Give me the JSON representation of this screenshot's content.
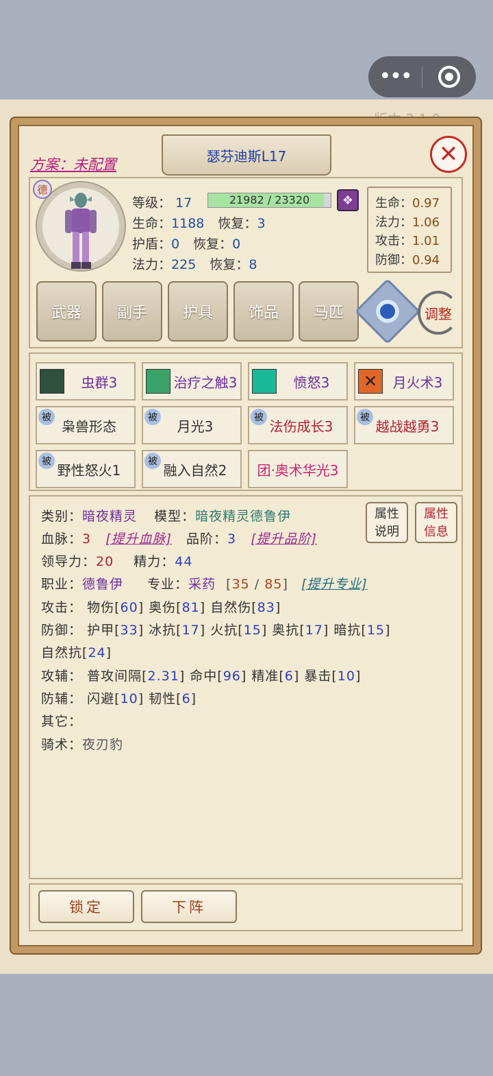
{
  "miniprogram": {
    "more_glyph": "•••",
    "version_text": "版本 2.1.0"
  },
  "header": {
    "plan": "方案：未配置",
    "title": "瑟芬迪斯L17",
    "close_glyph": "✕"
  },
  "character": {
    "badge": "德",
    "level_label": "等级：",
    "level": "17",
    "xp_text": "21982 / 23320",
    "xp_progress": 0.943,
    "hp_label": "生命：",
    "hp": "1188",
    "hp_regen_label": "恢复：",
    "hp_regen": "3",
    "shield_label": "护盾：",
    "shield": "0",
    "shield_regen_label": "恢复：",
    "shield_regen": "0",
    "mana_label": "法力：",
    "mana": "225",
    "mana_regen_label": "恢复：",
    "mana_regen": "8"
  },
  "ratios": [
    {
      "label": "生命：",
      "value": "0.97"
    },
    {
      "label": "法力：",
      "value": "1.06"
    },
    {
      "label": "攻击：",
      "value": "1.01"
    },
    {
      "label": "防御：",
      "value": "0.94"
    }
  ],
  "equipment": [
    "武器",
    "副手",
    "护具",
    "饰品",
    "马匹"
  ],
  "adjust_label": "调整",
  "skills": [
    {
      "name": "虫群3",
      "color": "#6e2f9c",
      "icon": "swarm-icon",
      "icon_color": "#2f4f3f"
    },
    {
      "name": "治疗之触3",
      "color": "#6e2f9c",
      "icon": "healing-leaf-icon",
      "icon_color": "#3aa36a"
    },
    {
      "name": "愤怒3",
      "color": "#6e2f9c",
      "icon": "wrath-icon",
      "icon_color": "#1bb89a"
    },
    {
      "name": "月火术3",
      "color": "#6e2f9c",
      "icon": "moonfire-icon",
      "icon_color": "#e0662a"
    }
  ],
  "passives": [
    {
      "tag": "被",
      "name": "枭兽形态",
      "color": "#333333"
    },
    {
      "tag": "被",
      "name": "月光3",
      "color": "#333333"
    },
    {
      "tag": "被",
      "name": "法伤成长3",
      "color": "#b3232f"
    },
    {
      "tag": "被",
      "name": "越战越勇3",
      "color": "#b3232f"
    },
    {
      "tag": "被",
      "name": "野性怒火1",
      "color": "#333333"
    },
    {
      "tag": "被",
      "name": "融入自然2",
      "color": "#333333"
    },
    {
      "tag": "",
      "name": "团·奥术华光3",
      "color": "#c8246e"
    }
  ],
  "info": {
    "category_label": "类别：",
    "category": "暗夜精灵",
    "model_label": "模型：",
    "model": "暗夜精灵德鲁伊",
    "bloodline_label": "血脉：",
    "bloodline": "3",
    "bloodline_link": "[提升血脉]",
    "grade_label": "品阶：",
    "grade": "3",
    "grade_link": "[提升品阶]",
    "leadership_label": "领导力：",
    "leadership": "20",
    "energy_label": "精力：",
    "energy": "44",
    "job_label": "职业：",
    "job": "德鲁伊",
    "spec_label": "专业：",
    "spec": "采药",
    "spec_open": "[",
    "spec_cur": "35",
    "spec_sep": " / ",
    "spec_max": "85",
    "spec_close": "]",
    "spec_link": "[提升专业]",
    "attack_label": "攻击：",
    "attack": [
      {
        "name": "物伤",
        "value": "60"
      },
      {
        "name": "奥伤",
        "value": "81"
      },
      {
        "name": "自然伤",
        "value": "83"
      }
    ],
    "defense_label": "防御：",
    "defense": [
      {
        "name": "护甲",
        "value": "33"
      },
      {
        "name": "冰抗",
        "value": "17"
      },
      {
        "name": "火抗",
        "value": "15"
      },
      {
        "name": "奥抗",
        "value": "17"
      },
      {
        "name": "暗抗",
        "value": "15"
      }
    ],
    "defense_extra_name": "自然抗",
    "defense_extra_value": "24",
    "atk_aux_label": "攻辅：",
    "atk_aux": [
      {
        "name": "普攻间隔",
        "value": "2.31"
      },
      {
        "name": "命中",
        "value": "96"
      },
      {
        "name": "精准",
        "value": "6"
      },
      {
        "name": "暴击",
        "value": "10"
      }
    ],
    "def_aux_label": "防辅：",
    "def_aux": [
      {
        "name": "闪避",
        "value": "10"
      },
      {
        "name": "韧性",
        "value": "6"
      }
    ],
    "other_label": "其它：",
    "riding_label": "骑术：",
    "riding": "夜刃豹"
  },
  "attr_buttons": [
    {
      "line1": "属性",
      "line2": "说明",
      "color": "#333333"
    },
    {
      "line1": "属性",
      "line2": "信息",
      "color": "#b3232f"
    }
  ],
  "buttons": {
    "lock": "锁定",
    "unstage": "下阵"
  }
}
